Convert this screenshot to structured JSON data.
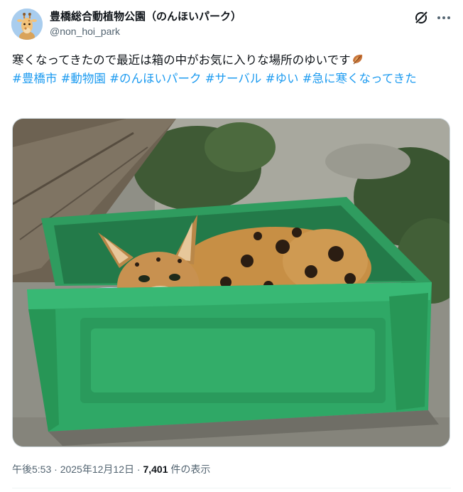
{
  "author": {
    "display_name": "豊橋総合動植物公園（のんほいパーク）",
    "handle": "@non_hoi_park",
    "avatar_icon": "giraffe-avatar-icon"
  },
  "header_actions": {
    "grok_icon": "grok-slash-icon",
    "more_icon": "more-dots-icon"
  },
  "post": {
    "text": "寒くなってきたので最近は箱の中がお気に入りな場所のゆいです",
    "emoji_icon": "fallen-leaf-icon",
    "hashtags": [
      "#豊橋市",
      "#動物園",
      "#のんほいパーク",
      "#サーバル",
      "#ゆい",
      "#急に寒くなってきた"
    ]
  },
  "media": {
    "alt": "serval-in-green-crate-photo"
  },
  "meta": {
    "time": "午後5:53",
    "separator": "·",
    "date": "2025年12月12日",
    "views_count": "7,401",
    "views_label": "件の表示"
  },
  "colors": {
    "link": "#1d9bf0",
    "text": "#0f1419",
    "secondary": "#536471",
    "crate": "#2fa866"
  }
}
